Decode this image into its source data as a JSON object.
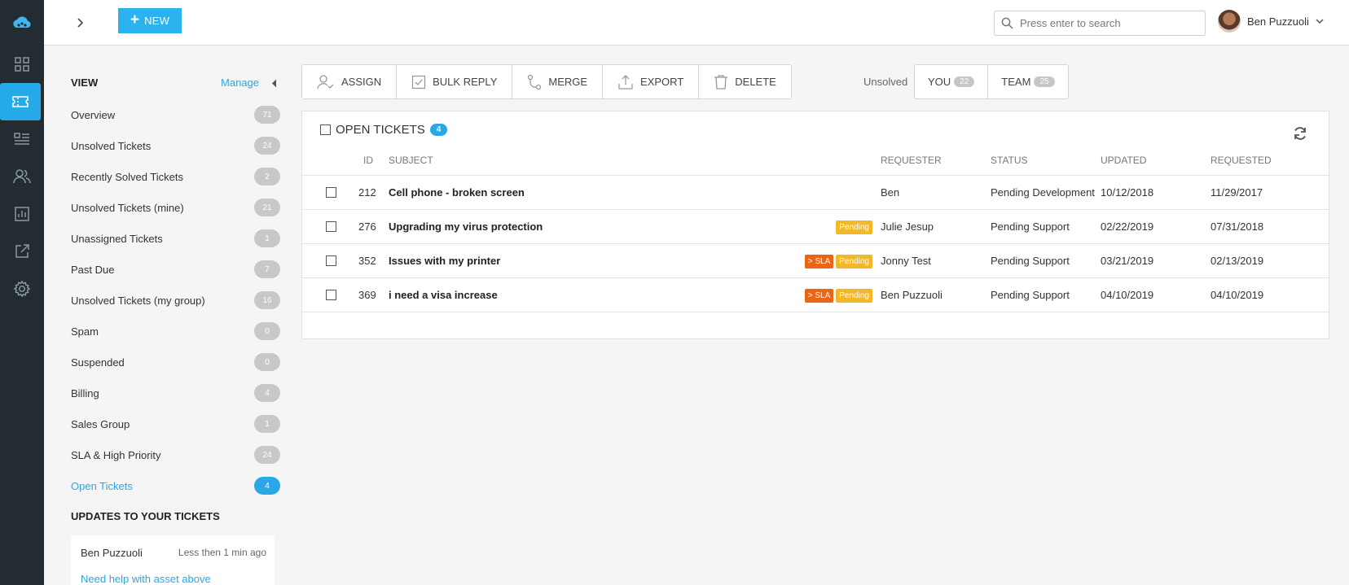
{
  "topbar": {
    "new_label": "NEW",
    "search_placeholder": "Press enter to search",
    "user_name": "Ben Puzzuoli"
  },
  "sidebar": {
    "view_title": "VIEW",
    "manage_label": "Manage",
    "items": [
      {
        "label": "Overview",
        "count": "71"
      },
      {
        "label": "Unsolved Tickets",
        "count": "24"
      },
      {
        "label": "Recently Solved Tickets",
        "count": "2"
      },
      {
        "label": "Unsolved Tickets (mine)",
        "count": "21"
      },
      {
        "label": "Unassigned Tickets",
        "count": "1"
      },
      {
        "label": "Past Due",
        "count": "7"
      },
      {
        "label": "Unsolved Tickets (my group)",
        "count": "16"
      },
      {
        "label": "Spam",
        "count": "0"
      },
      {
        "label": "Suspended",
        "count": "0"
      },
      {
        "label": "Billing",
        "count": "4"
      },
      {
        "label": "Sales Group",
        "count": "1"
      },
      {
        "label": "SLA & High Priority",
        "count": "24"
      },
      {
        "label": "Open Tickets",
        "count": "4"
      }
    ],
    "updates_title": "UPDATES TO YOUR TICKETS",
    "update": {
      "name": "Ben Puzzuoli",
      "time": "Less then 1 min ago",
      "message": "Need help with asset above"
    }
  },
  "toolbar": {
    "assign": "ASSIGN",
    "bulk_reply": "BULK REPLY",
    "merge": "MERGE",
    "export": "EXPORT",
    "delete": "DELETE"
  },
  "unsolved": {
    "label": "Unsolved",
    "you_label": "YOU",
    "you_count": "22",
    "team_label": "TEAM",
    "team_count": "25"
  },
  "tickets": {
    "title": "OPEN TICKETS",
    "count": "4",
    "columns": {
      "id": "ID",
      "subject": "SUBJECT",
      "requester": "REQUESTER",
      "status": "STATUS",
      "updated": "UPDATED",
      "requested": "REQUESTED"
    },
    "rows": [
      {
        "id": "212",
        "subject": "Cell phone - broken screen",
        "sla": "",
        "pending": "",
        "requester": "Ben",
        "status": "Pending Development",
        "updated": "10/12/2018",
        "requested": "11/29/2017"
      },
      {
        "id": "276",
        "subject": "Upgrading my virus protection",
        "sla": "",
        "pending": "Pending",
        "requester": "Julie Jesup",
        "status": "Pending Support",
        "updated": "02/22/2019",
        "requested": "07/31/2018"
      },
      {
        "id": "352",
        "subject": "Issues with my printer",
        "sla": "> SLA",
        "pending": "Pending",
        "requester": "Jonny Test",
        "status": "Pending Support",
        "updated": "03/21/2019",
        "requested": "02/13/2019"
      },
      {
        "id": "369",
        "subject": "i need a visa increase",
        "sla": "> SLA",
        "pending": "Pending",
        "requester": "Ben Puzzuoli",
        "status": "Pending Support",
        "updated": "04/10/2019",
        "requested": "04/10/2019"
      }
    ]
  },
  "colors": {
    "accent": "#2aa7e6",
    "rail": "#232d31",
    "pending": "#f1b92a",
    "sla": "#ea6616"
  }
}
